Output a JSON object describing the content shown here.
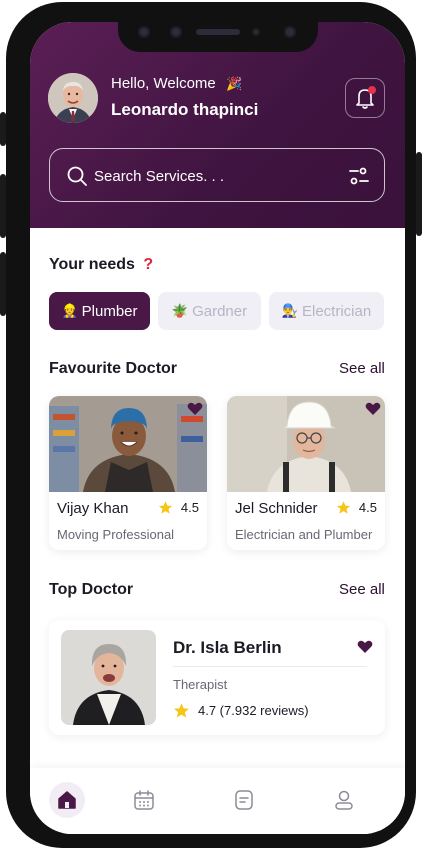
{
  "header": {
    "greeting": "Hello, Welcome",
    "greeting_emoji": "🎉",
    "user_name": "Leonardo thapinci"
  },
  "search": {
    "placeholder": "Search Services. . ."
  },
  "needs": {
    "title": "Your needs",
    "title_mark": "?",
    "chips": [
      {
        "icon": "👷",
        "label": "Plumber",
        "active": true
      },
      {
        "icon": "🪴",
        "label": "Gardner",
        "active": false
      },
      {
        "icon": "👨‍🔧",
        "label": "Electrician",
        "active": false
      }
    ]
  },
  "favourite": {
    "title": "Favourite Doctor",
    "see_all": "See all",
    "cards": [
      {
        "name": "Vijay Khan",
        "rating": "4.5",
        "subtitle": "Moving Professional"
      },
      {
        "name": "Jel Schnider",
        "rating": "4.5",
        "subtitle": "Electrician and Plumber"
      }
    ]
  },
  "top": {
    "title": "Top Doctor",
    "see_all": "See all",
    "card": {
      "name": "Dr. Isla Berlin",
      "role": "Therapist",
      "rating_text": "4.7 (7.932 reviews)"
    }
  },
  "nav": {
    "items": [
      "home-icon",
      "calendar-icon",
      "document-icon",
      "profile-icon"
    ],
    "active_index": 0
  },
  "colors": {
    "primary": "#4a1846",
    "header_bg": "#3f1440",
    "star": "#f5c518",
    "badge": "#e5324a"
  }
}
